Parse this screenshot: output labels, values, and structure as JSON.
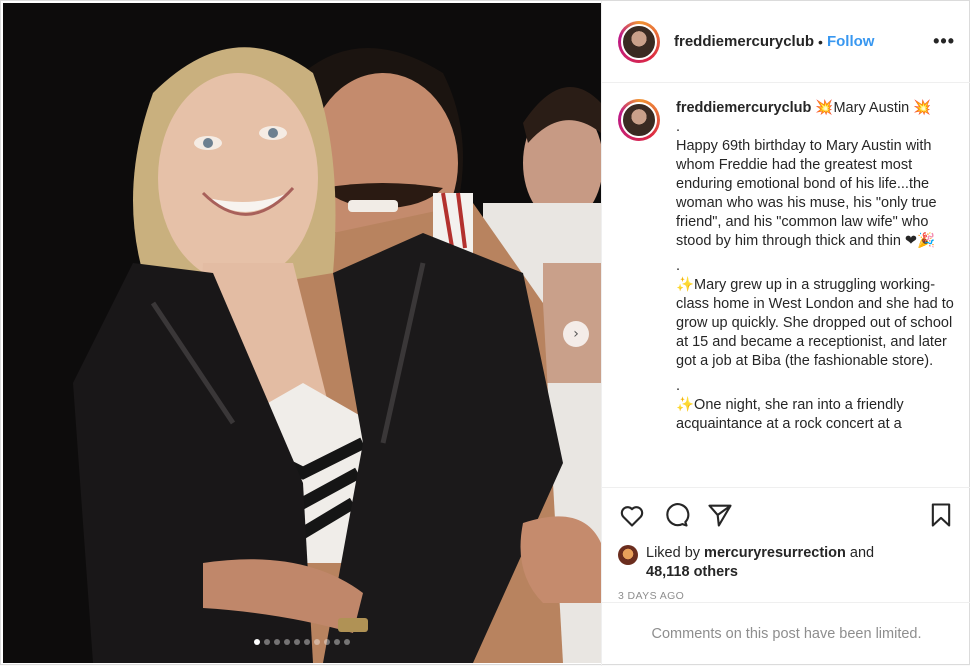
{
  "post": {
    "username": "freddiemercuryclub",
    "separator": "•",
    "follow_label": "Follow",
    "more_label": "•••",
    "carousel": {
      "total": 10,
      "active": 1,
      "next_label": "›"
    }
  },
  "caption": {
    "username": "freddiemercuryclub",
    "lines": [
      "💥Mary Austin 💥",
      ".",
      "Happy 69th birthday to Mary Austin with whom Freddie had the greatest most enduring emotional bond of his life...the woman who was his muse, his \"only true friend\", and his \"common law wife\" who stood by him through thick and thin ❤🎉",
      ".",
      "✨Mary grew up in a struggling working-class home in West London and she had to grow up quickly. She dropped out of school at 15 and became a receptionist, and later got a job at Biba (the fashionable store).",
      ".",
      "✨One night, she ran into a friendly acquaintance at a rock concert at a"
    ]
  },
  "likes": {
    "prefix": "Liked by ",
    "user": "mercuryresurrection",
    "middle": " and",
    "count": "48,118 others"
  },
  "timestamp": "3 DAYS AGO",
  "comments_limited": "Comments on this post have been limited.",
  "icons": [
    "heart-icon",
    "comment-icon",
    "share-icon",
    "bookmark-icon",
    "more-icon"
  ]
}
